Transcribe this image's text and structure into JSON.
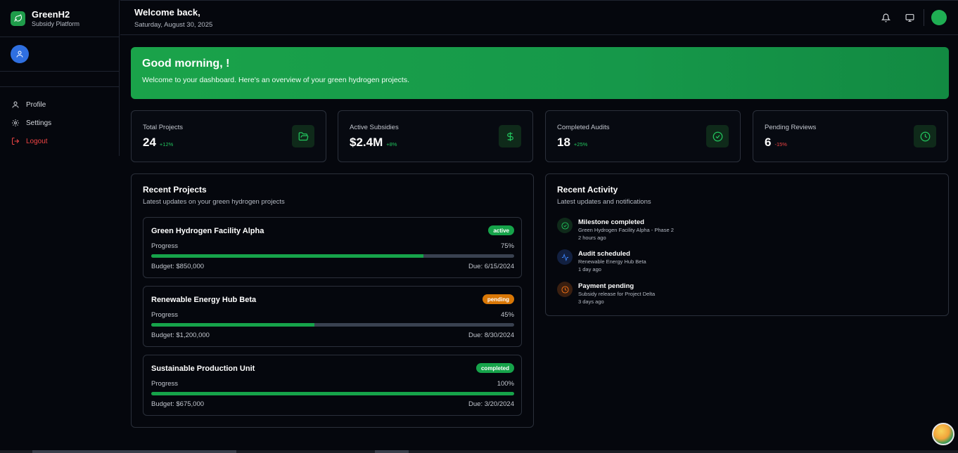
{
  "brand": {
    "name": "GreenH2",
    "subtitle": "Subsidy Platform"
  },
  "sidebar": {
    "items": [
      {
        "label": "Profile",
        "icon": "user-icon"
      },
      {
        "label": "Settings",
        "icon": "gear-icon"
      },
      {
        "label": "Logout",
        "icon": "logout-icon"
      }
    ]
  },
  "header": {
    "welcome": "Welcome back,",
    "date": "Saturday, August 30, 2025"
  },
  "banner": {
    "title": "Good morning, !",
    "subtitle": "Welcome to your dashboard. Here's an overview of your green hydrogen projects."
  },
  "stats": [
    {
      "label": "Total Projects",
      "value": "24",
      "change": "+12%",
      "trend": "up",
      "icon": "folder-icon"
    },
    {
      "label": "Active Subsidies",
      "value": "$2.4M",
      "change": "+8%",
      "trend": "up",
      "icon": "dollar-icon"
    },
    {
      "label": "Completed Audits",
      "value": "18",
      "change": "+25%",
      "trend": "up",
      "icon": "check-circle-icon"
    },
    {
      "label": "Pending Reviews",
      "value": "6",
      "change": "-15%",
      "trend": "down",
      "icon": "clock-icon"
    }
  ],
  "projects_panel": {
    "title": "Recent Projects",
    "subtitle": "Latest updates on your green hydrogen projects",
    "progress_label": "Progress",
    "projects": [
      {
        "name": "Green Hydrogen Facility Alpha",
        "status": "active",
        "progress": 75,
        "progress_text": "75%",
        "budget": "Budget: $850,000",
        "due": "Due: 6/15/2024"
      },
      {
        "name": "Renewable Energy Hub Beta",
        "status": "pending",
        "progress": 45,
        "progress_text": "45%",
        "budget": "Budget: $1,200,000",
        "due": "Due: 8/30/2024"
      },
      {
        "name": "Sustainable Production Unit",
        "status": "completed",
        "progress": 100,
        "progress_text": "100%",
        "budget": "Budget: $675,000",
        "due": "Due: 3/20/2024"
      }
    ]
  },
  "activity_panel": {
    "title": "Recent Activity",
    "subtitle": "Latest updates and notifications",
    "items": [
      {
        "title": "Milestone completed",
        "desc": "Green Hydrogen Facility Alpha - Phase 2",
        "time": "2 hours ago",
        "icon": "check-circle-icon",
        "color": "#22c55e"
      },
      {
        "title": "Audit scheduled",
        "desc": "Renewable Energy Hub Beta",
        "time": "1 day ago",
        "icon": "activity-icon",
        "color": "#3b82f6"
      },
      {
        "title": "Payment pending",
        "desc": "Subsidy release for Project Delta",
        "time": "3 days ago",
        "icon": "clock-icon",
        "color": "#f97316"
      }
    ]
  },
  "colors": {
    "accent": "#16a34a",
    "background": "#05070d",
    "danger": "#ef4444",
    "warning": "#d97706"
  }
}
